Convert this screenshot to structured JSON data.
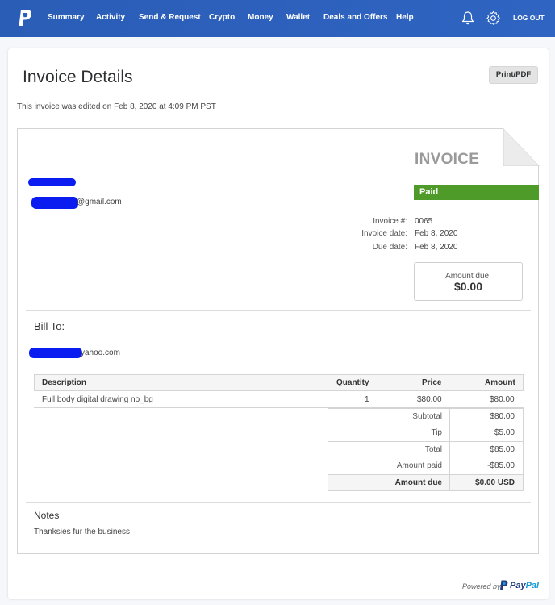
{
  "nav": {
    "items": [
      "Summary",
      "Activity",
      "Send & Request",
      "Crypto",
      "Money",
      "Wallet",
      "Deals and Offers",
      "Help"
    ],
    "logout": "LOG OUT",
    "icons": {
      "logo": "paypal-logo-icon",
      "notifications": "bell-icon",
      "settings": "gear-icon"
    },
    "color": "#2b5fb8"
  },
  "page": {
    "title": "Invoice Details",
    "print_label": "Print/PDF",
    "edited_note": "This invoice was edited on Feb 8, 2020 at 4:09 PM PST"
  },
  "invoice": {
    "heading": "INVOICE",
    "status": "Paid",
    "status_color": "#4f9b2a",
    "sender_email_suffix": "@gmail.com",
    "meta": [
      {
        "label": "Invoice #:",
        "value": "0065"
      },
      {
        "label": "Invoice date:",
        "value": "Feb 8, 2020"
      },
      {
        "label": "Due date:",
        "value": "Feb 8, 2020"
      }
    ],
    "amount_due_label": "Amount due:",
    "amount_due_value": "$0.00",
    "bill_to_label": "Bill To:",
    "bill_to_email_suffix": "yahoo.com",
    "table": {
      "headers": [
        "Description",
        "Quantity",
        "Price",
        "Amount"
      ],
      "rows": [
        {
          "description": "Full body digital drawing no_bg",
          "quantity": "1",
          "price": "$80.00",
          "amount": "$80.00"
        }
      ]
    },
    "totals": [
      {
        "label": "Subtotal",
        "value": "$80.00"
      },
      {
        "label": "Tip",
        "value": "$5.00"
      },
      {
        "label": "Total",
        "value": "$85.00"
      },
      {
        "label": "Amount paid",
        "value": "-$85.00"
      },
      {
        "label": "Amount due",
        "value": "$0.00 USD"
      }
    ],
    "notes_label": "Notes",
    "notes_text": "Thanksies fur the business"
  },
  "footer": {
    "powered_by": "Powered by",
    "brand_pay": "Pay",
    "brand_pal": "Pal"
  }
}
